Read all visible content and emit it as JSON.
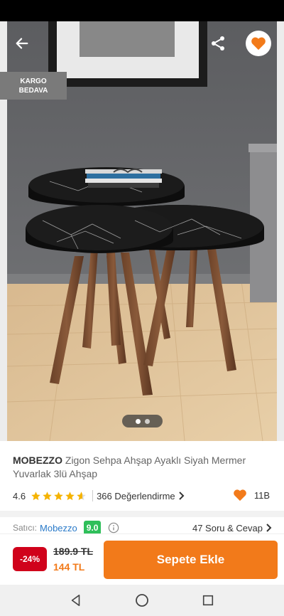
{
  "header": {
    "back_icon": "arrow-left-icon",
    "share_icon": "share-icon",
    "favorite_icon": "heart-icon"
  },
  "badge": {
    "line1": "KARGO",
    "line2": "BEDAVA"
  },
  "gallery": {
    "image_count": 2,
    "active_index": 0
  },
  "product": {
    "brand": "MOBEZZO",
    "name": "Zigon Sehpa Ahşap Ayaklı Siyah Mermer Yuvarlak 3lü Ahşap"
  },
  "rating": {
    "score": "4.6",
    "stars": 4.6,
    "reviews_label": "366 Değerlendirme",
    "likes": "11B"
  },
  "seller": {
    "label": "Satıcı:",
    "name": "Mobezzo",
    "score": "9.0",
    "qa_label": "47 Soru & Cevap"
  },
  "pricing": {
    "discount": "-24%",
    "old_price": "189.9 TL",
    "new_price": "144 TL",
    "cart_button": "Sepete Ekle"
  },
  "colors": {
    "accent": "#f27a1a",
    "discount": "#d0021b",
    "seller_score": "#2fbf5a",
    "link": "#2a7ac9"
  }
}
